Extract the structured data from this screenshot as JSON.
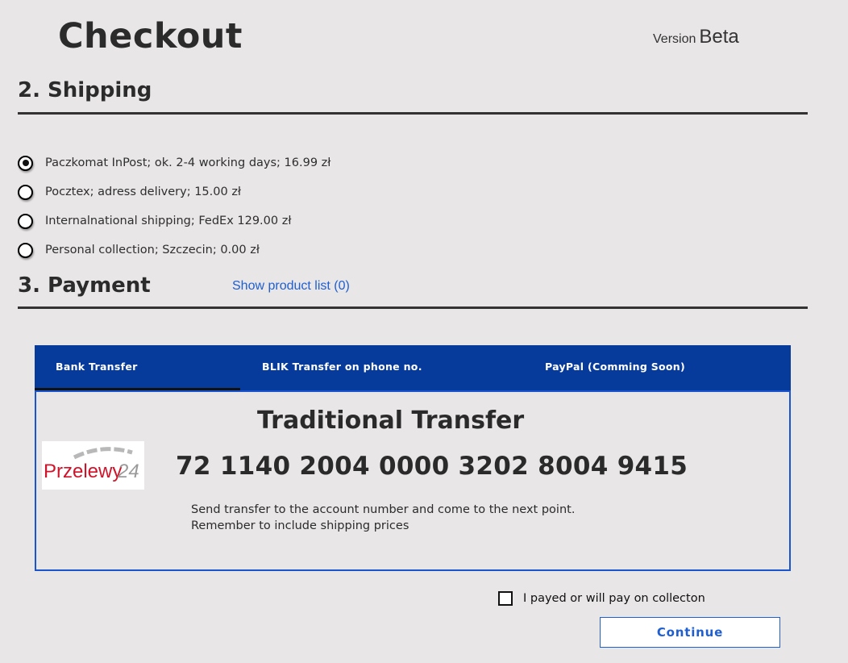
{
  "header": {
    "title": "Checkout",
    "version_label": "Version",
    "version_value": "Beta"
  },
  "shipping": {
    "title": "2. Shipping",
    "options": [
      {
        "label": "Paczkomat InPost; ok. 2-4 working days; 16.99 zł",
        "selected": true
      },
      {
        "label": "Pocztex; adress delivery; 15.00 zł",
        "selected": false
      },
      {
        "label": "Internalnational shipping; FedEx 129.00 zł",
        "selected": false
      },
      {
        "label": "Personal collection; Szczecin; 0.00 zł",
        "selected": false
      }
    ]
  },
  "payment": {
    "title": "3. Payment",
    "show_products_link": "Show product list (0)",
    "tabs": [
      {
        "label": "Bank Transfer",
        "active": true
      },
      {
        "label": "BLIK Transfer on phone no.",
        "active": false
      },
      {
        "label": "PayPal (Comming Soon)",
        "active": false
      }
    ],
    "panel": {
      "title": "Traditional Transfer",
      "logo_text": "Przelewy24",
      "account_number": "72 1140 2004 0000 3202 8004 9415",
      "instructions_line1": "Send transfer  to the account number and come to the next point.",
      "instructions_line2": "Remember to include shipping prices"
    },
    "brand_color": "#063b9c",
    "accent_color": "#1a55cf"
  },
  "confirm": {
    "checkbox_label": "I payed or will pay on collecton",
    "checked": false,
    "continue_label": "Continue"
  }
}
